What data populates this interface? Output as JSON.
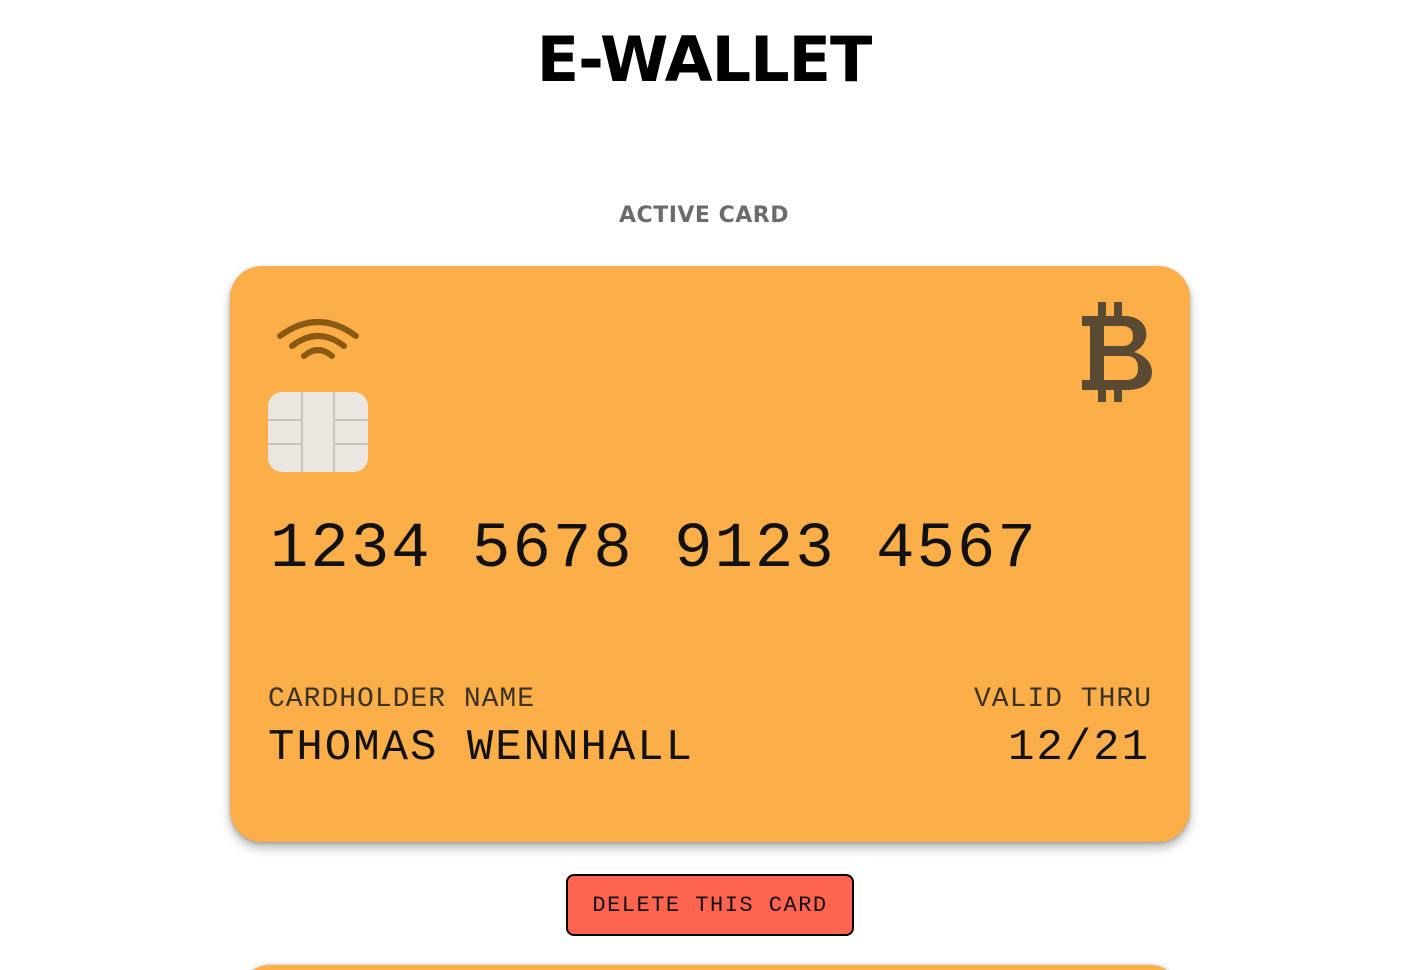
{
  "header": {
    "title": "E-WALLET"
  },
  "active_section": {
    "label": "ACTIVE CARD"
  },
  "card": {
    "vendor_icon": "bitcoin-icon",
    "contactless_icon": "contactless-icon",
    "chip_icon": "chip-icon",
    "number": "1234 5678 9123 4567",
    "holder_label": "CARDHOLDER NAME",
    "holder_name": "THOMAS WENNHALL",
    "valid_label": "VALID THRU",
    "valid_thru": "12/21",
    "background_color": "#fcae48",
    "icon_color": "#5a4a32"
  },
  "actions": {
    "delete_label": "DELETE THIS CARD",
    "delete_color": "#ff6450"
  }
}
